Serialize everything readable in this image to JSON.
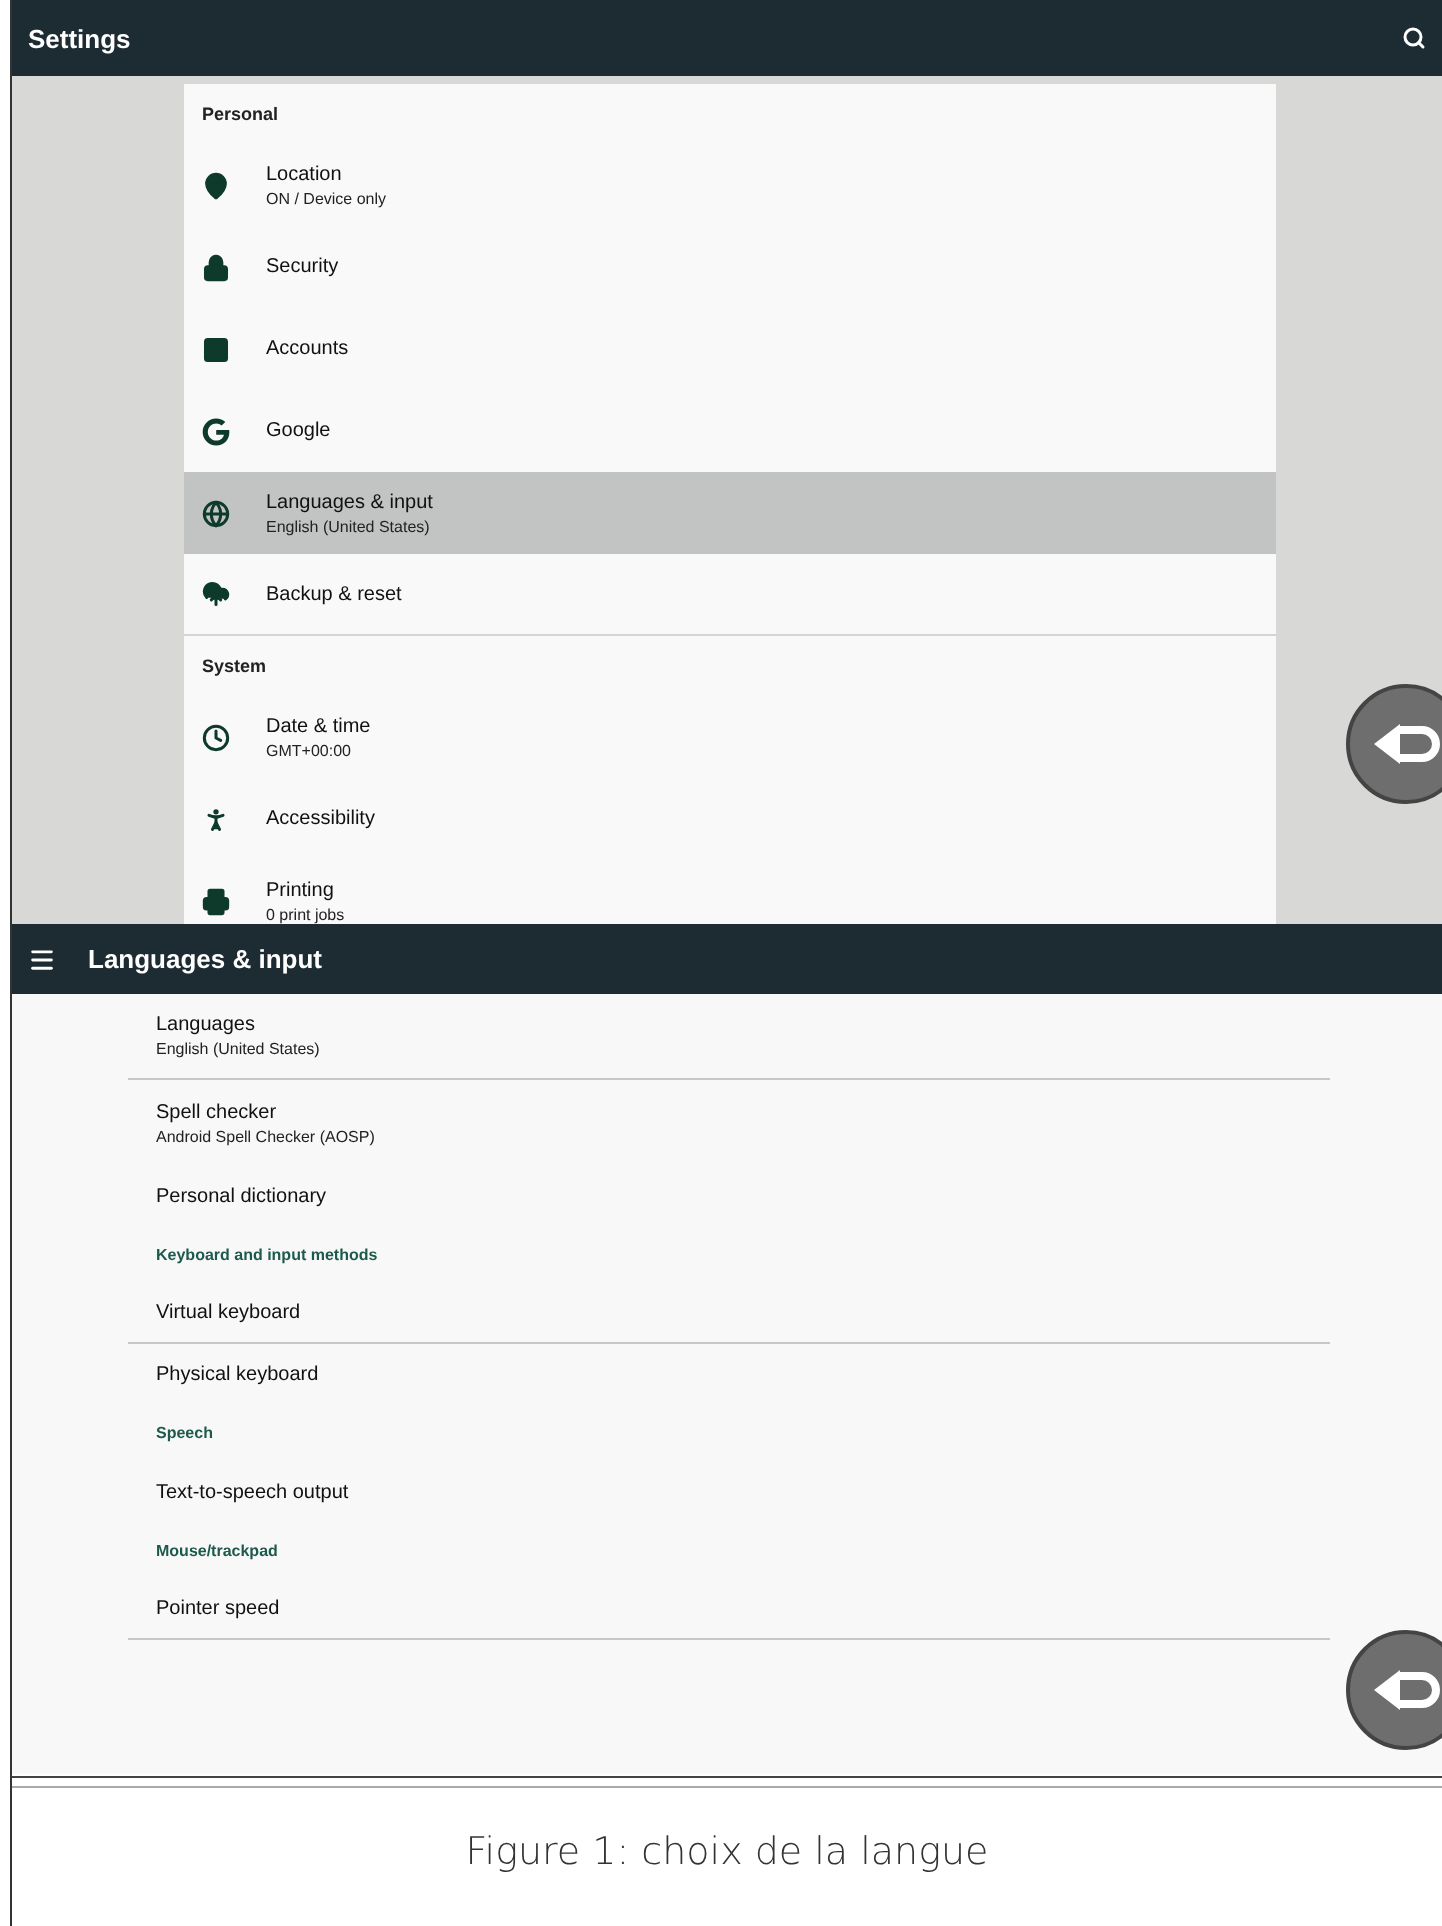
{
  "settings_screen": {
    "title": "Settings",
    "items": [
      {
        "kind": "header",
        "label": "Personal"
      },
      {
        "kind": "item",
        "label": "Location",
        "sub": "ON / Device only",
        "selected": false
      },
      {
        "kind": "item",
        "label": "Security",
        "selected": false
      },
      {
        "kind": "item",
        "label": "Accounts",
        "selected": false
      },
      {
        "kind": "item",
        "label": "Google",
        "selected": false
      },
      {
        "kind": "item",
        "label": "Languages & input",
        "sub": "English (United States)",
        "selected": true
      },
      {
        "kind": "item",
        "label": "Backup & reset",
        "selected": false,
        "divider": true
      },
      {
        "kind": "header",
        "label": "System"
      },
      {
        "kind": "item",
        "label": "Date & time",
        "sub": "GMT+00:00",
        "selected": false
      },
      {
        "kind": "item",
        "label": "Accessibility",
        "selected": false
      },
      {
        "kind": "item",
        "label": "Printing",
        "sub": "0 print jobs",
        "selected": false
      }
    ]
  },
  "languages_screen": {
    "title": "Languages & input",
    "items": [
      {
        "kind": "item",
        "label": "Languages",
        "sub": "English (United States)",
        "divider": true
      },
      {
        "kind": "item",
        "label": "Spell checker",
        "sub": "Android Spell Checker (AOSP)"
      },
      {
        "kind": "item",
        "label": "Personal dictionary"
      },
      {
        "kind": "header",
        "label": "Keyboard and input methods"
      },
      {
        "kind": "item",
        "label": "Virtual keyboard",
        "divider": true
      },
      {
        "kind": "item",
        "label": "Physical keyboard"
      },
      {
        "kind": "header",
        "label": "Speech"
      },
      {
        "kind": "item",
        "label": "Text-to-speech output"
      },
      {
        "kind": "header",
        "label": "Mouse/trackpad"
      },
      {
        "kind": "item",
        "label": "Pointer speed",
        "divider": true
      }
    ]
  },
  "caption": "Figure 1: choix de la langue"
}
